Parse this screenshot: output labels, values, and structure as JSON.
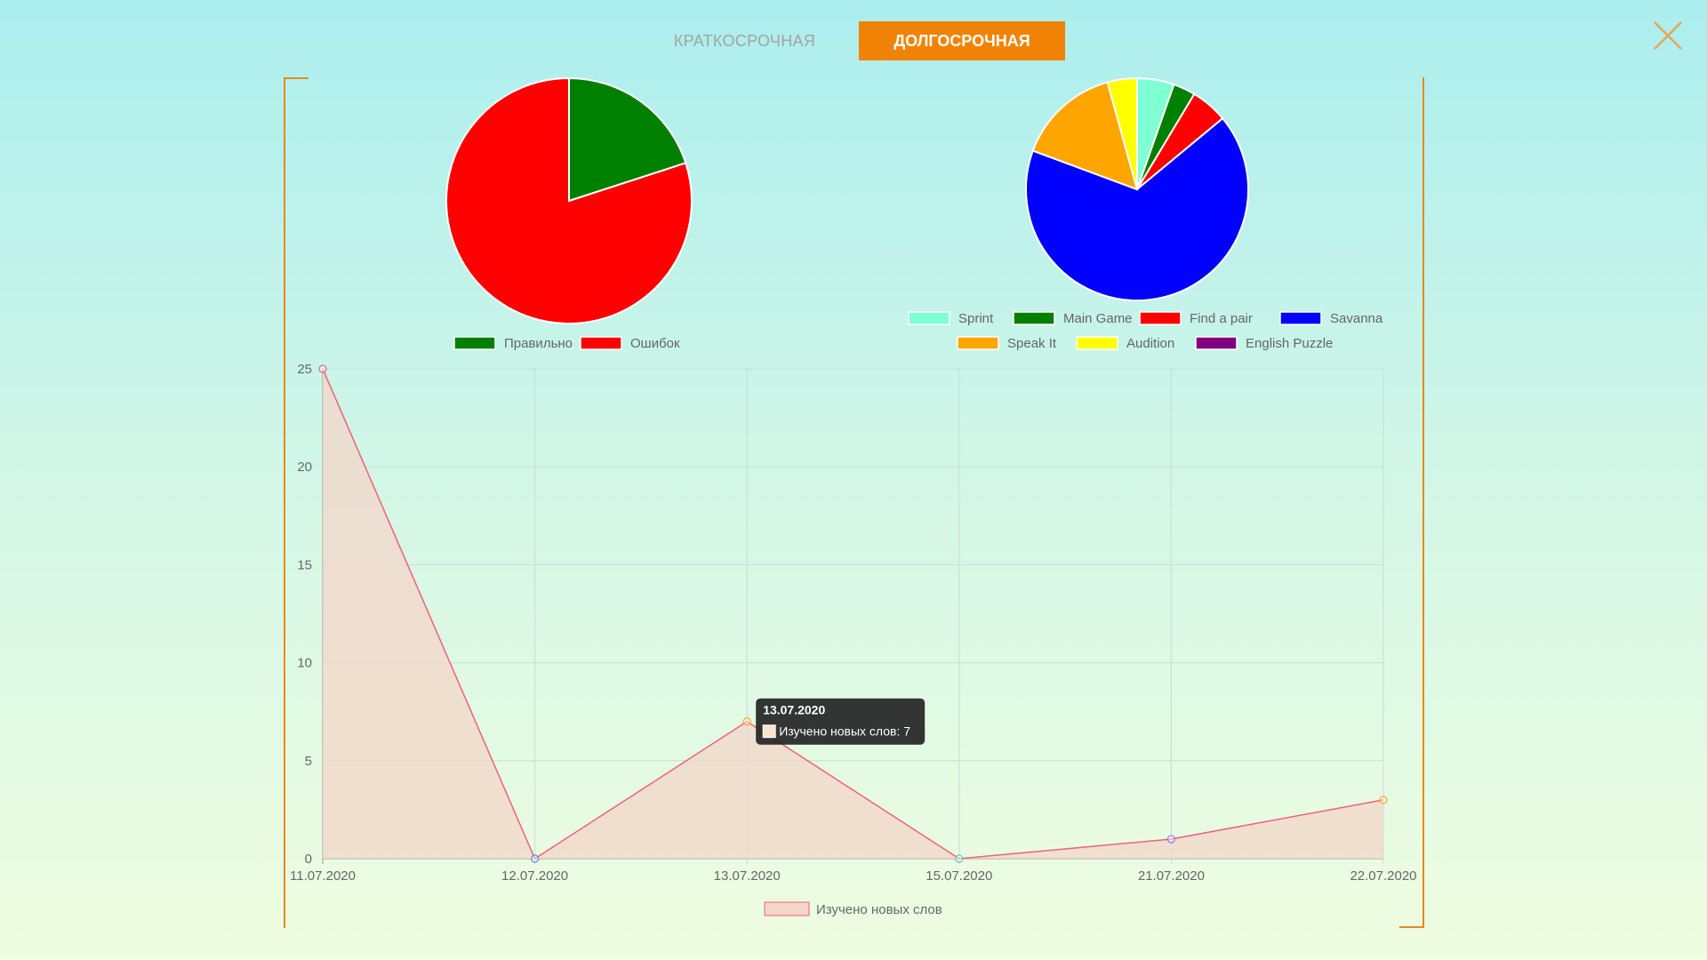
{
  "tabs": [
    {
      "label": "Краткосрочная",
      "active": false
    },
    {
      "label": "Долгосрочная",
      "active": true
    }
  ],
  "colors": {
    "accent": "#f08306",
    "bracket": "#e68a1c",
    "line": "#f0607a",
    "fill": "#f3d6c8"
  },
  "icons": {
    "close": "close-icon"
  },
  "chart_data": [
    {
      "type": "pie",
      "labels": [
        "Правильно",
        "Ошибок"
      ],
      "values": [
        20,
        80
      ],
      "colors": [
        "#008000",
        "#ff0000"
      ]
    },
    {
      "type": "pie",
      "labels": [
        "Sprint",
        "Main Game",
        "Find a pair",
        "Savanna",
        "Speak It",
        "Audition",
        "English Puzzle"
      ],
      "values": [
        5,
        3,
        5,
        62,
        14,
        4,
        0
      ],
      "colors": [
        "#7fffd4",
        "#008000",
        "#ff0000",
        "#0000ff",
        "#ffa500",
        "#ffff00",
        "#800080"
      ]
    },
    {
      "type": "area",
      "categories": [
        "11.07.2020",
        "12.07.2020",
        "13.07.2020",
        "15.07.2020",
        "21.07.2020",
        "22.07.2020"
      ],
      "series": [
        {
          "name": "Изучено новых слов",
          "values": [
            25,
            0,
            7,
            0,
            1,
            3
          ]
        }
      ],
      "ylim": [
        0,
        25
      ],
      "yticks": [
        0,
        5,
        10,
        15,
        20,
        25
      ],
      "grid": true,
      "legend": "bottom",
      "point_colors": [
        "#f0607a",
        "#5b8fd8",
        "#f5a623",
        "#5fc9c9",
        "#9b6cf0",
        "#f5a623"
      ],
      "tooltip": {
        "title": "13.07.2020",
        "label": "Изучено новых слов: 7",
        "category_index": 2
      }
    }
  ]
}
